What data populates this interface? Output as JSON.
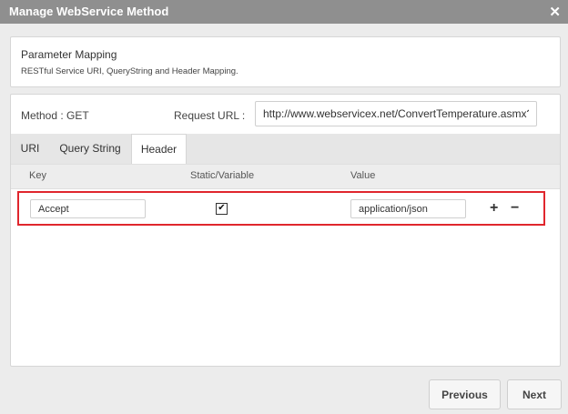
{
  "dialog": {
    "title": "Manage WebService Method",
    "close_icon": "✕"
  },
  "parameter_mapping": {
    "heading": "Parameter Mapping",
    "description": "RESTful Service URI, QueryString and Header Mapping."
  },
  "method": {
    "label": "Method  :  GET",
    "request_url_label": "Request URL  :",
    "request_url_value": "http://www.webservicex.net/ConvertTemperature.asmx?"
  },
  "tabs": [
    {
      "label": "URI",
      "active": false
    },
    {
      "label": "Query String",
      "active": false
    },
    {
      "label": "Header",
      "active": true
    }
  ],
  "columns": {
    "key": "Key",
    "static_variable": "Static/Variable",
    "value": "Value"
  },
  "rows": [
    {
      "key": "Accept",
      "static_checked": true,
      "value": "application/json"
    }
  ],
  "row_actions": {
    "add": "+",
    "remove": "−"
  },
  "footer": {
    "previous_label": "Previous",
    "next_label": "Next"
  },
  "colors": {
    "titlebar": "#8f8f8f",
    "highlight": "#e0262d"
  }
}
